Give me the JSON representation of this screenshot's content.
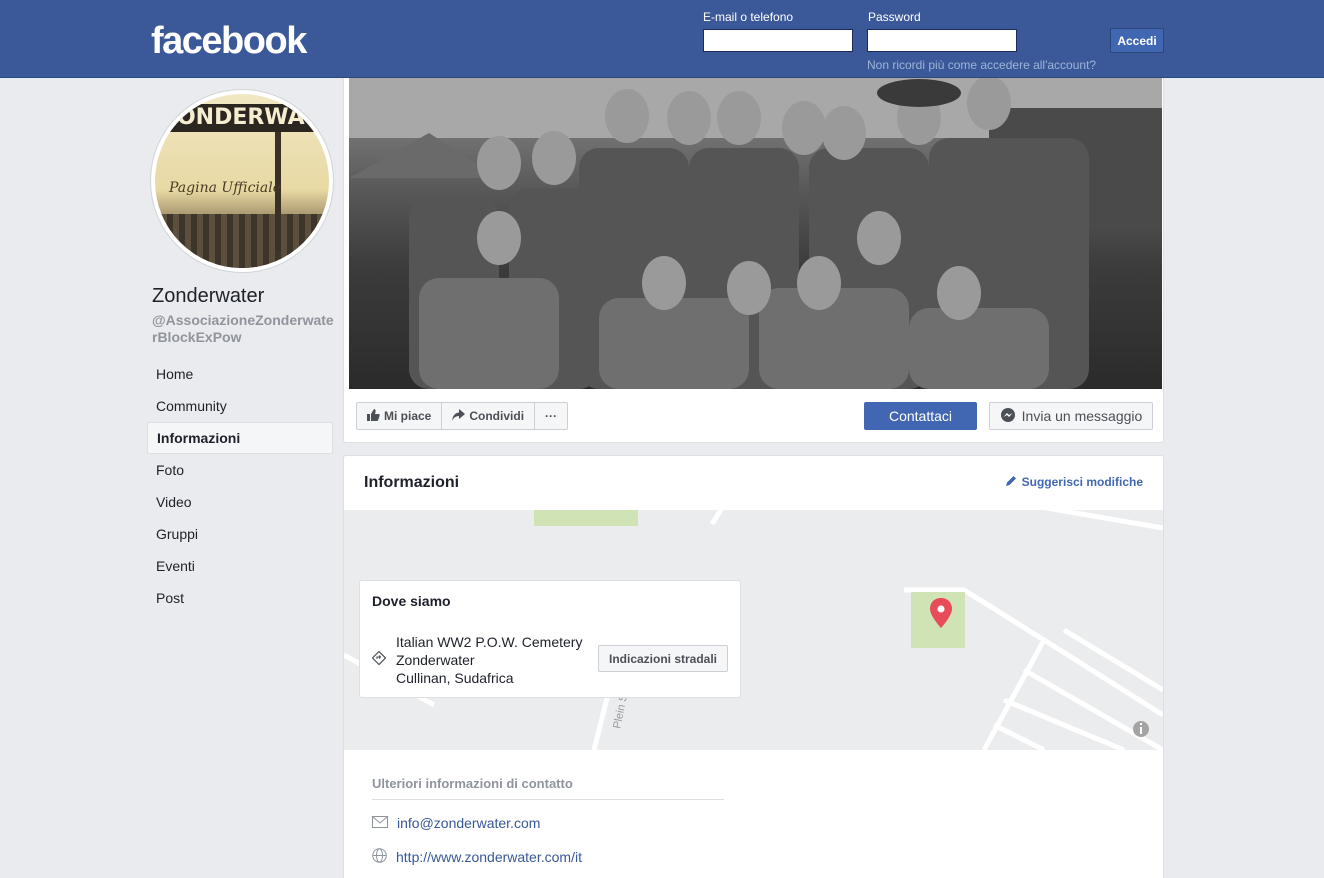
{
  "header": {
    "logo": "facebook",
    "email_label": "E-mail o telefono",
    "password_label": "Password",
    "forgot": "Non ricordi più come accedere all'account?",
    "login_button": "Accedi"
  },
  "page": {
    "name": "Zonderwater",
    "handle": "@AssociazioneZonderwaterBlockExPow",
    "avatar_sign": "ZONDERWATER",
    "avatar_script": "Pagina Ufficiale"
  },
  "nav": {
    "items": [
      {
        "label": "Home",
        "active": false
      },
      {
        "label": "Community",
        "active": false
      },
      {
        "label": "Informazioni",
        "active": true
      },
      {
        "label": "Foto",
        "active": false
      },
      {
        "label": "Video",
        "active": false
      },
      {
        "label": "Gruppi",
        "active": false
      },
      {
        "label": "Eventi",
        "active": false
      },
      {
        "label": "Post",
        "active": false
      }
    ]
  },
  "actions": {
    "like": "Mi piace",
    "share": "Condividi",
    "more": "···",
    "contact": "Contattaci",
    "message": "Invia un messaggio"
  },
  "info": {
    "title": "Informazioni",
    "suggest": "Suggerisci modifiche",
    "location_title": "Dove siamo",
    "address_line1": "Italian WW2 P.O.W. Cemetery",
    "address_line2": "Zonderwater",
    "address_line3": "Cullinan, Sudafrica",
    "directions": "Indicazioni stradali",
    "street": "Plein St",
    "more_contact": "Ulteriori informazioni di contatto",
    "email": "info@zonderwater.com",
    "website": "http://www.zonderwater.com/it"
  },
  "colors": {
    "brand": "#3b5998",
    "button": "#4267b2",
    "pin": "#e84c5b",
    "park": "#cfe3b4"
  }
}
